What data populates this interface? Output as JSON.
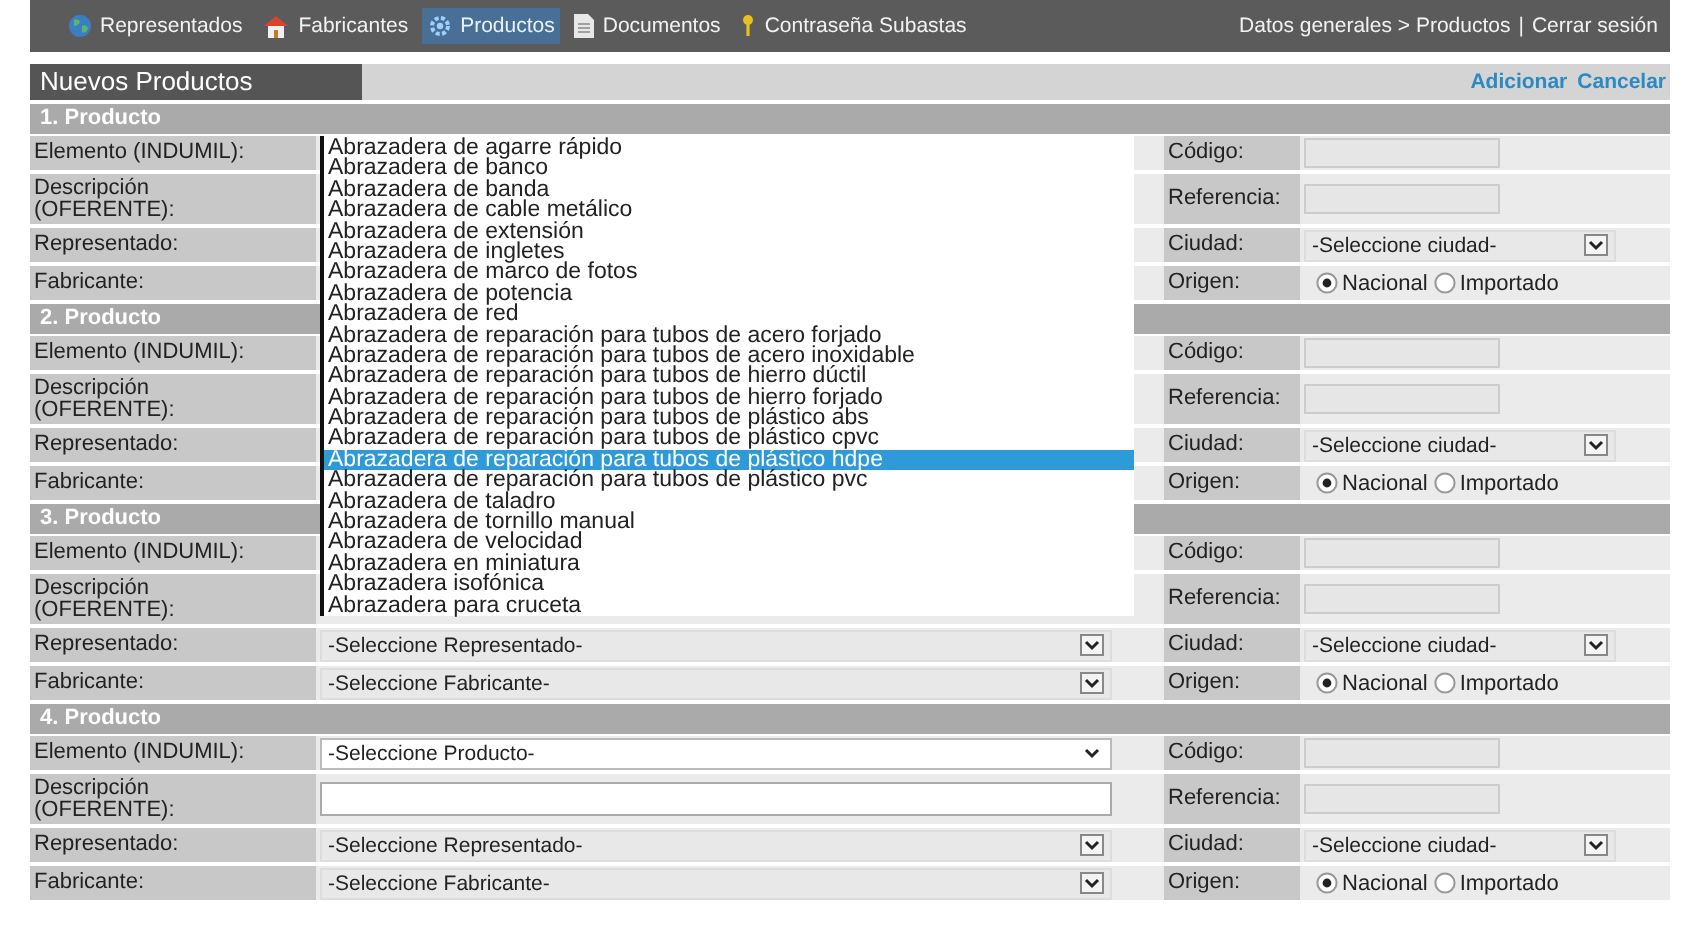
{
  "nav": {
    "items": [
      {
        "label": "Representados",
        "selected": false
      },
      {
        "label": "Fabricantes",
        "selected": false
      },
      {
        "label": "Productos",
        "selected": true
      },
      {
        "label": "Documentos",
        "selected": false
      },
      {
        "label": "Contraseña Subastas",
        "selected": false
      }
    ],
    "breadcrumb": "Datos generales > Productos",
    "separator": "|",
    "logout": "Cerrar sesión"
  },
  "title": "Nuevos Productos",
  "actions": [
    "Adicionar",
    "Cancelar"
  ],
  "sections": [
    {
      "title": "1. Producto",
      "rows": [
        {
          "label": "Elemento (INDUMIL):",
          "right_label": "Código:",
          "right_field": {
            "kind": "input"
          }
        },
        {
          "label": "Descripción (OFERENTE):",
          "tall": true,
          "right_label": "Referencia:",
          "right_field": {
            "kind": "input"
          }
        },
        {
          "label": "Representado:",
          "right_label": "Ciudad:",
          "right_field": {
            "kind": "select",
            "value": "-Seleccione ciudad-",
            "disabled": true
          }
        },
        {
          "label": "Fabricante:",
          "right_label": "Origen:",
          "right_field": {
            "kind": "radio",
            "options": [
              {
                "label": "Nacional",
                "selected": true
              },
              {
                "label": "Importado",
                "selected": false
              }
            ]
          }
        }
      ]
    },
    {
      "title": "2. Producto",
      "rows": [
        {
          "label": "Elemento (INDUMIL):",
          "right_label": "Código:",
          "right_field": {
            "kind": "input"
          }
        },
        {
          "label": "Descripción (OFERENTE):",
          "tall": true,
          "right_label": "Referencia:",
          "right_field": {
            "kind": "input"
          }
        },
        {
          "label": "Representado:",
          "right_label": "Ciudad:",
          "right_field": {
            "kind": "select",
            "value": "-Seleccione ciudad-",
            "disabled": true
          }
        },
        {
          "label": "Fabricante:",
          "right_label": "Origen:",
          "right_field": {
            "kind": "radio",
            "options": [
              {
                "label": "Nacional",
                "selected": true
              },
              {
                "label": "Importado",
                "selected": false
              }
            ]
          }
        }
      ]
    },
    {
      "title": "3. Producto",
      "rows": [
        {
          "label": "Elemento (INDUMIL):",
          "right_label": "Código:",
          "right_field": {
            "kind": "input"
          }
        },
        {
          "label": "Descripción (OFERENTE):",
          "tall": true,
          "right_label": "Referencia:",
          "right_field": {
            "kind": "input"
          }
        },
        {
          "label": "Representado:",
          "field": {
            "kind": "select",
            "value": "-Seleccione Representado-",
            "disabled": true
          },
          "right_label": "Ciudad:",
          "right_field": {
            "kind": "select",
            "value": "-Seleccione ciudad-",
            "disabled": true
          }
        },
        {
          "label": "Fabricante:",
          "field": {
            "kind": "select",
            "value": "-Seleccione Fabricante-",
            "disabled": true
          },
          "right_label": "Origen:",
          "right_field": {
            "kind": "radio",
            "options": [
              {
                "label": "Nacional",
                "selected": true
              },
              {
                "label": "Importado",
                "selected": false
              }
            ]
          }
        }
      ]
    },
    {
      "title": "4. Producto",
      "rows": [
        {
          "label": "Elemento (INDUMIL):",
          "field": {
            "kind": "select",
            "value": "-Seleccione Producto-",
            "disabled": false
          },
          "right_label": "Código:",
          "right_field": {
            "kind": "input"
          }
        },
        {
          "label": "Descripción (OFERENTE):",
          "tall": true,
          "field": {
            "kind": "input"
          },
          "right_label": "Referencia:",
          "right_field": {
            "kind": "input"
          }
        },
        {
          "label": "Representado:",
          "field": {
            "kind": "select",
            "value": "-Seleccione Representado-",
            "disabled": true
          },
          "right_label": "Ciudad:",
          "right_field": {
            "kind": "select",
            "value": "-Seleccione ciudad-",
            "disabled": true
          }
        },
        {
          "label": "Fabricante:",
          "field": {
            "kind": "select",
            "value": "-Seleccione Fabricante-",
            "disabled": true
          },
          "right_label": "Origen:",
          "right_field": {
            "kind": "radio",
            "options": [
              {
                "label": "Nacional",
                "selected": true
              },
              {
                "label": "Importado",
                "selected": false
              }
            ]
          }
        }
      ]
    }
  ],
  "dropdown_list": {
    "items": [
      {
        "label": "Abrazadera de agarre rápido",
        "selected": false
      },
      {
        "label": "Abrazadera de banco",
        "selected": false
      },
      {
        "label": "Abrazadera de banda",
        "selected": false
      },
      {
        "label": "Abrazadera de cable metálico",
        "selected": false
      },
      {
        "label": "Abrazadera de extensión",
        "selected": false
      },
      {
        "label": "Abrazadera de ingletes",
        "selected": false
      },
      {
        "label": "Abrazadera de marco de fotos",
        "selected": false
      },
      {
        "label": "Abrazadera de potencia",
        "selected": false
      },
      {
        "label": "Abrazadera de red",
        "selected": false
      },
      {
        "label": "Abrazadera de reparación para tubos de acero forjado",
        "selected": false
      },
      {
        "label": "Abrazadera de reparación para tubos de acero inoxidable",
        "selected": false
      },
      {
        "label": "Abrazadera de reparación para tubos de hierro dúctil",
        "selected": false
      },
      {
        "label": "Abrazadera de reparación para tubos de hierro forjado",
        "selected": false
      },
      {
        "label": "Abrazadera de reparación para tubos de plástico abs",
        "selected": false
      },
      {
        "label": "Abrazadera de reparación para tubos de plástico cpvc",
        "selected": false
      },
      {
        "label": "Abrazadera de reparación para tubos de plástico hdpe",
        "selected": true
      },
      {
        "label": "Abrazadera de reparación para tubos de plástico pvc",
        "selected": false
      },
      {
        "label": "Abrazadera de taladro",
        "selected": false
      },
      {
        "label": "Abrazadera de tornillo manual",
        "selected": false
      },
      {
        "label": "Abrazadera de velocidad",
        "selected": false
      },
      {
        "label": "Abrazadera en miniatura",
        "selected": false
      },
      {
        "label": "Abrazadera isofónica",
        "selected": false
      },
      {
        "label": "Abrazadera para cruceta",
        "selected": false
      }
    ]
  }
}
